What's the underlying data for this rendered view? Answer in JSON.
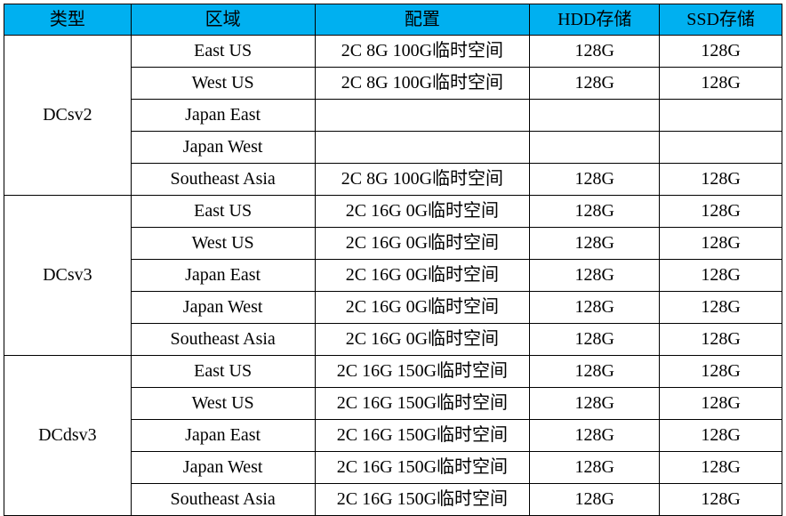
{
  "header": {
    "type": "类型",
    "region": "区域",
    "config": "配置",
    "hdd": "HDD存储",
    "ssd": "SSD存储"
  },
  "groups": [
    {
      "type": "DCsv2",
      "rows": [
        {
          "region": "East US",
          "config": "2C 8G 100G临时空间",
          "hdd": "128G",
          "ssd": "128G"
        },
        {
          "region": "West US",
          "config": "2C 8G 100G临时空间",
          "hdd": "128G",
          "ssd": "128G"
        },
        {
          "region": "Japan East",
          "config": "",
          "hdd": "",
          "ssd": ""
        },
        {
          "region": "Japan West",
          "config": "",
          "hdd": "",
          "ssd": ""
        },
        {
          "region": "Southeast Asia",
          "config": "2C 8G 100G临时空间",
          "hdd": "128G",
          "ssd": "128G"
        }
      ]
    },
    {
      "type": "DCsv3",
      "rows": [
        {
          "region": "East US",
          "config": "2C 16G 0G临时空间",
          "hdd": "128G",
          "ssd": "128G"
        },
        {
          "region": "West US",
          "config": "2C 16G 0G临时空间",
          "hdd": "128G",
          "ssd": "128G"
        },
        {
          "region": "Japan East",
          "config": "2C 16G 0G临时空间",
          "hdd": "128G",
          "ssd": "128G"
        },
        {
          "region": "Japan West",
          "config": "2C 16G 0G临时空间",
          "hdd": "128G",
          "ssd": "128G"
        },
        {
          "region": "Southeast Asia",
          "config": "2C 16G 0G临时空间",
          "hdd": "128G",
          "ssd": "128G"
        }
      ]
    },
    {
      "type": "DCdsv3",
      "rows": [
        {
          "region": "East US",
          "config": "2C 16G 150G临时空间",
          "hdd": "128G",
          "ssd": "128G"
        },
        {
          "region": "West US",
          "config": "2C 16G 150G临时空间",
          "hdd": "128G",
          "ssd": "128G"
        },
        {
          "region": "Japan East",
          "config": "2C 16G 150G临时空间",
          "hdd": "128G",
          "ssd": "128G"
        },
        {
          "region": "Japan West",
          "config": "2C 16G 150G临时空间",
          "hdd": "128G",
          "ssd": "128G"
        },
        {
          "region": "Southeast Asia",
          "config": "2C 16G 150G临时空间",
          "hdd": "128G",
          "ssd": "128G"
        }
      ]
    }
  ],
  "colors": {
    "header_bg": "#00b0f0",
    "border": "#000000"
  }
}
